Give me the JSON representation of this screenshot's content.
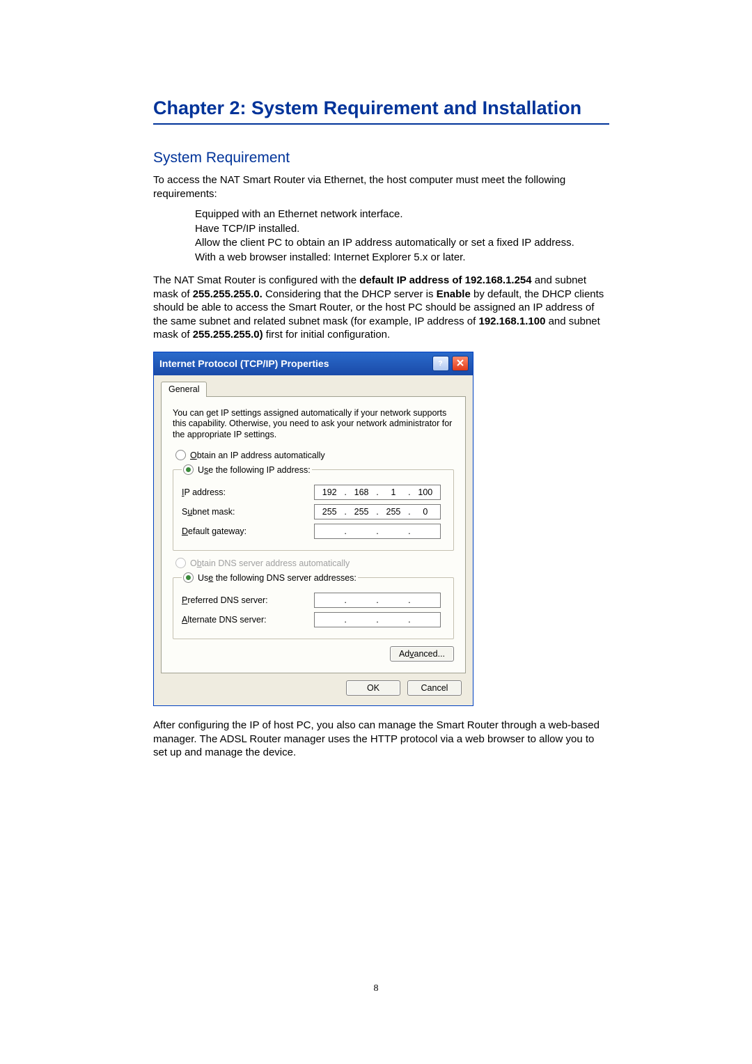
{
  "doc": {
    "chapter_title": "Chapter 2: System Requirement and Installation",
    "section_title": "System Requirement",
    "intro": "To access the NAT Smart Router via Ethernet, the host computer must meet the following requirements:",
    "bullets": {
      "b1": "Equipped with an Ethernet network interface.",
      "b2": "Have TCP/IP installed.",
      "b3": "Allow the client PC to obtain an IP address automatically or set a fixed IP address.",
      "b4": "With a web browser installed: Internet Explorer 5.x or later."
    },
    "para2_pre": "The NAT Smat Router is configured with the ",
    "para2_b1": "default IP address of 192.168.1.254",
    "para2_mid1": " and subnet mask of ",
    "para2_b2": "255.255.255.0.",
    "para2_mid2": " Considering that the DHCP server is ",
    "para2_b3": "Enable",
    "para2_mid3": " by default, the DHCP clients should be able to access the Smart Router, or the host PC should be assigned an IP address of the same subnet and related subnet mask (for example, IP address of ",
    "para2_b4": "192.168.1.100",
    "para2_mid4": " and subnet mask of ",
    "para2_b5": "255.255.255.0)",
    "para2_end": " first for initial configuration.",
    "after_dialog": "After configuring the IP of host PC, you also can manage the Smart Router through a web-based manager. The ADSL Router manager uses the HTTP protocol via a web browser to allow you to set up and manage the device.",
    "page_number": "8"
  },
  "dialog": {
    "title": "Internet Protocol (TCP/IP) Properties",
    "tab": "General",
    "intro": "You can get IP settings assigned automatically if your network supports this capability. Otherwise, you need to ask your network administrator for the appropriate IP settings.",
    "radio_obtain_ip_pre": "O",
    "radio_obtain_ip_rest": "btain an IP address automatically",
    "radio_use_ip_pre": "U",
    "radio_use_ip_u": "s",
    "radio_use_ip_rest": "e the following IP address:",
    "ip_label_u": "I",
    "ip_label_rest": "P address:",
    "subnet_label_pre": "S",
    "subnet_label_u": "u",
    "subnet_label_rest": "bnet mask:",
    "gateway_label_u": "D",
    "gateway_label_rest": "efault gateway:",
    "radio_obtain_dns_pre": "O",
    "radio_obtain_dns_u": "b",
    "radio_obtain_dns_rest": "tain DNS server address automatically",
    "radio_use_dns_pre": "Us",
    "radio_use_dns_u": "e",
    "radio_use_dns_rest": " the following DNS server addresses:",
    "pref_dns_label_u": "P",
    "pref_dns_label_rest": "referred DNS server:",
    "alt_dns_label_u": "A",
    "alt_dns_label_rest": "lternate DNS server:",
    "advanced_pre": "Ad",
    "advanced_u": "v",
    "advanced_rest": "anced...",
    "ok": "OK",
    "cancel": "Cancel",
    "values": {
      "ip": {
        "o1": "192",
        "o2": "168",
        "o3": "1",
        "o4": "100"
      },
      "mask": {
        "o1": "255",
        "o2": "255",
        "o3": "255",
        "o4": "0"
      },
      "gateway": {
        "o1": "",
        "o2": "",
        "o3": "",
        "o4": ""
      },
      "pref_dns": {
        "o1": "",
        "o2": "",
        "o3": "",
        "o4": ""
      },
      "alt_dns": {
        "o1": "",
        "o2": "",
        "o3": "",
        "o4": ""
      }
    }
  }
}
